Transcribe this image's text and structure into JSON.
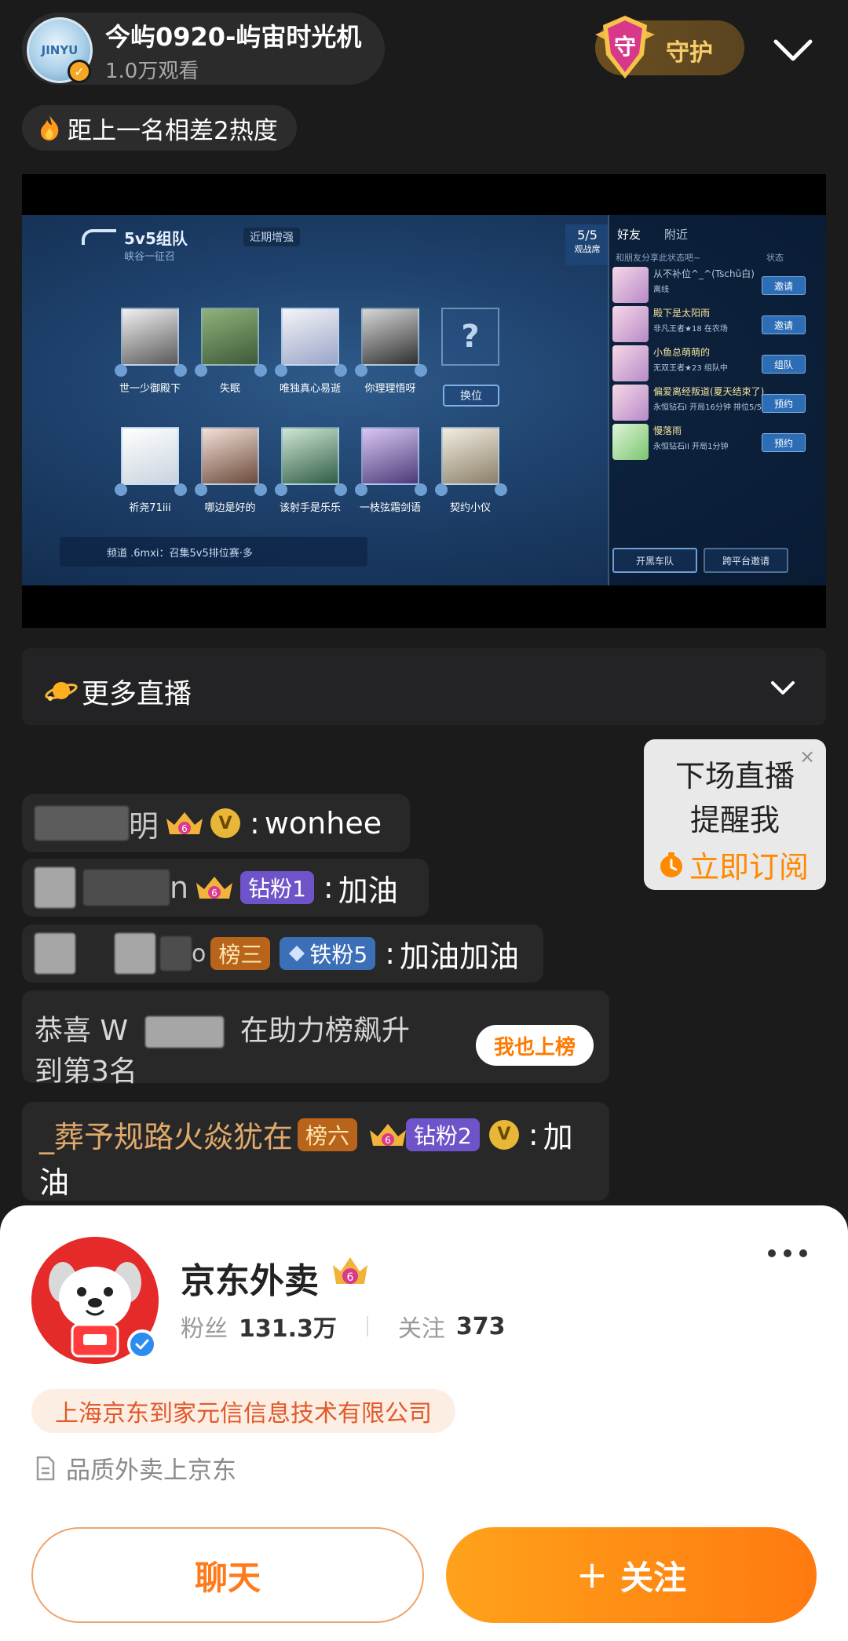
{
  "header": {
    "host_name": "今屿0920-屿宙时光机",
    "viewers": "1.0万观看",
    "avatar_text": "JINYU",
    "guard_label": "守护",
    "guard_shield_char": "守"
  },
  "rank_notice": {
    "text": "距上一名相差2热度"
  },
  "stream": {
    "team_title": "5v5组队",
    "team_sub": "峡谷一征召",
    "tag": "近期增强",
    "players_top": [
      "世一少御殿下",
      "失眠",
      "唯独真心易逝",
      "你理理悟呀"
    ],
    "players_bottom": [
      "祈尧71iii",
      "哪边是好的",
      "该射手是乐乐",
      "一枝弦霜剑语",
      "契约小仪"
    ],
    "swap_label": "换位",
    "empty_slot": "?",
    "bottom_hint": "频道 .6mxi：召集5v5排位赛·多",
    "counter_num": "5/5",
    "counter_label": "观战席",
    "tabs": [
      "好友",
      "附近"
    ],
    "search_hint": "和朋友分享此状态吧~",
    "status_label": "状态",
    "friends": [
      {
        "name": "从不补位^_^(Tschū白)",
        "sub": "离线",
        "btn": "邀请"
      },
      {
        "name": "殿下是太阳雨",
        "sub": "非凡王者★18 在农场",
        "btn": "邀请"
      },
      {
        "name": "小鱼总萌萌的",
        "sub": "无双王者★23 组队中",
        "btn": "组队"
      },
      {
        "name": "偏爱离经叛道(夏天结束了)",
        "sub": "永恒钻石I 开局16分钟 排位5/5",
        "btn": "预约"
      },
      {
        "name": "慢落雨",
        "sub": "永恒钻石II 开局1分钟",
        "btn": "预约"
      }
    ],
    "panel_btn_1": "开黑车队",
    "panel_btn_2": "跨平台邀请"
  },
  "more_live": {
    "label": "更多直播"
  },
  "chat": {
    "msg1": {
      "name_tail": "明",
      "level": "6",
      "vbadge": "V",
      "text": "wonhee"
    },
    "msg2": {
      "name_tail": "n",
      "level": "6",
      "fan_badge": "钻粉1",
      "text": "加油"
    },
    "msg3": {
      "name_tail": "o",
      "rank_badge": "榜三",
      "fan_badge": "铁粉5",
      "text": "加油加油"
    },
    "congrats": {
      "prefix": "恭喜 W",
      "suffix": "在助力榜飙升",
      "line2": "到第3名",
      "button": "我也上榜"
    },
    "msg4": {
      "name": "_葬予规路火焱犹在",
      "rank_badge": "榜六",
      "level": "6",
      "fan_badge": "钻粉2",
      "vbadge": "V",
      "text_l1": "加",
      "text_l2": "油"
    }
  },
  "reminder": {
    "line1": "下场直播",
    "line2": "提醒我",
    "action": "立即订阅",
    "close": "×"
  },
  "profile": {
    "name": "京东外卖",
    "level": "6",
    "fans_label": "粉丝",
    "fans_value": "131.3万",
    "follow_label": "关注",
    "follow_value": "373",
    "company": "上海京东到家元信信息技术有限公司",
    "desc": "品质外卖上京东",
    "chat_button": "聊天",
    "follow_button": "关注",
    "follow_plus": "+"
  },
  "colors": {
    "accent_orange": "#ff7a10",
    "gold": "#f7cd6b",
    "brand_red": "#e52a2a",
    "badge_purple": "#6e54c8",
    "badge_blue": "#3b6fb7",
    "badge_rank": "#b8651b"
  }
}
